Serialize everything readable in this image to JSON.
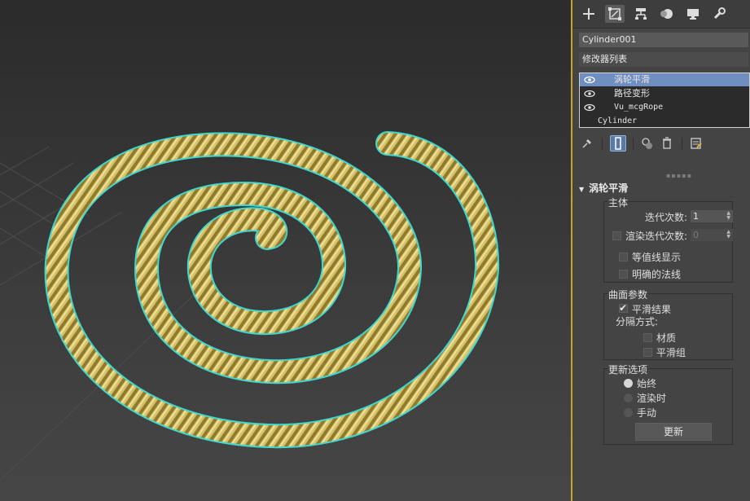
{
  "panel": {
    "object_name": "Cylinder001",
    "modifier_list_label": "修改器列表",
    "stack": [
      {
        "label": "涡轮平滑",
        "selected": true,
        "eye": true
      },
      {
        "label": "路径变形",
        "selected": false,
        "eye": true
      },
      {
        "label": "Vu_mcgRope",
        "selected": false,
        "eye": true
      },
      {
        "label": "Cylinder",
        "selected": false,
        "eye": false
      }
    ],
    "rollout_title": "涡轮平滑",
    "main_group": {
      "title": "主体",
      "iterations_label": "迭代次数:",
      "iterations_value": "1",
      "render_iters_label": "渲染迭代次数:",
      "render_iters_value": "0",
      "render_iters_checked": false,
      "isoline_label": "等值线显示",
      "isoline_checked": false,
      "explicit_normals_label": "明确的法线",
      "explicit_normals_checked": false
    },
    "surface_group": {
      "title": "曲面参数",
      "smooth_result_label": "平滑结果",
      "smooth_result_checked": true,
      "separate_by_label": "分隔方式:",
      "materials_label": "材质",
      "materials_checked": false,
      "smoothing_groups_label": "平滑组",
      "smoothing_groups_checked": false
    },
    "update_group": {
      "title": "更新选项",
      "options": [
        "始终",
        "渲染时",
        "手动"
      ],
      "selected_option": "始终",
      "update_button_label": "更新"
    }
  },
  "colors": {
    "rope": "#d9c46a",
    "selection_outline": "#3fd8d0",
    "active_stack_row": "#6f8fc0",
    "viewport_border": "#c9a22a"
  },
  "icons": [
    "create-icon",
    "modify-icon",
    "hierarchy-icon",
    "motion-icon",
    "display-icon",
    "utilities-icon",
    "pin-icon",
    "show-end-result-icon",
    "make-unique-icon",
    "remove-modifier-icon",
    "configure-sets-icon"
  ]
}
